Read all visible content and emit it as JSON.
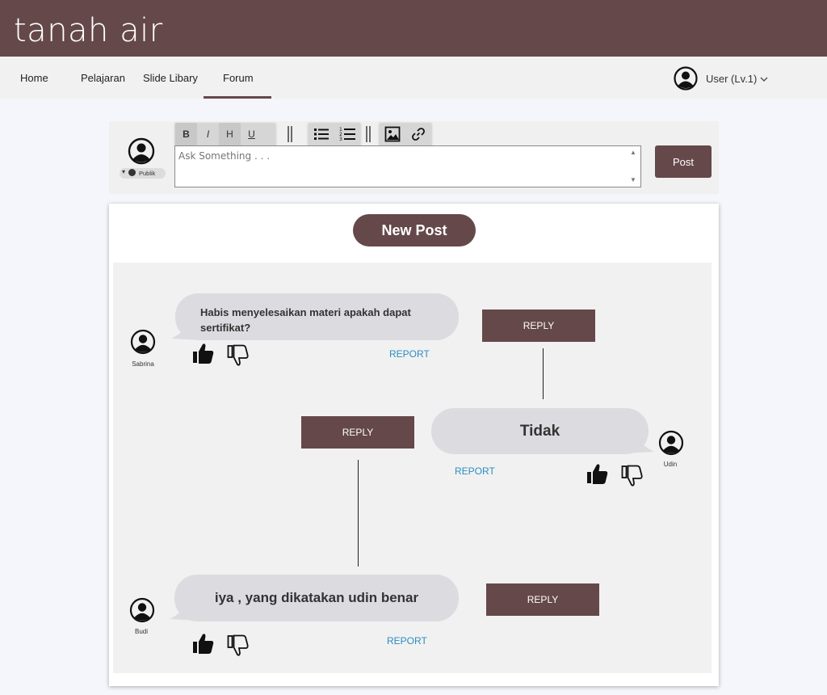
{
  "app": {
    "brand": "tanah air"
  },
  "nav": {
    "items": [
      {
        "label": "Home"
      },
      {
        "label": "Pelajaran"
      },
      {
        "label": "Slide Libary"
      },
      {
        "label": "Forum"
      }
    ],
    "active": "Forum",
    "user_label": "User (Lv.1)"
  },
  "compose": {
    "privacy_label": "Publik",
    "toolbar": {
      "bold": "B",
      "italic": "I",
      "heading": "H",
      "underline": "U"
    },
    "placeholder": "Ask Something . . .",
    "post_label": "Post"
  },
  "feed": {
    "new_post_label": "New Post",
    "posts": [
      {
        "author": "Sabrina",
        "text": "Habis menyelesaikan materi apakah dapat sertifikat?",
        "reply_label": "REPLY",
        "report_label": "REPORT"
      },
      {
        "author": "Udin",
        "text": "Tidak",
        "reply_label": "REPLY",
        "report_label": "REPORT"
      },
      {
        "author": "Budi",
        "text": "iya , yang dikatakan udin benar",
        "reply_label": "REPLY",
        "report_label": "REPORT"
      }
    ]
  },
  "colors": {
    "brand": "#65484a",
    "link": "#2a8ec0",
    "bubble": "#dcdce0"
  }
}
